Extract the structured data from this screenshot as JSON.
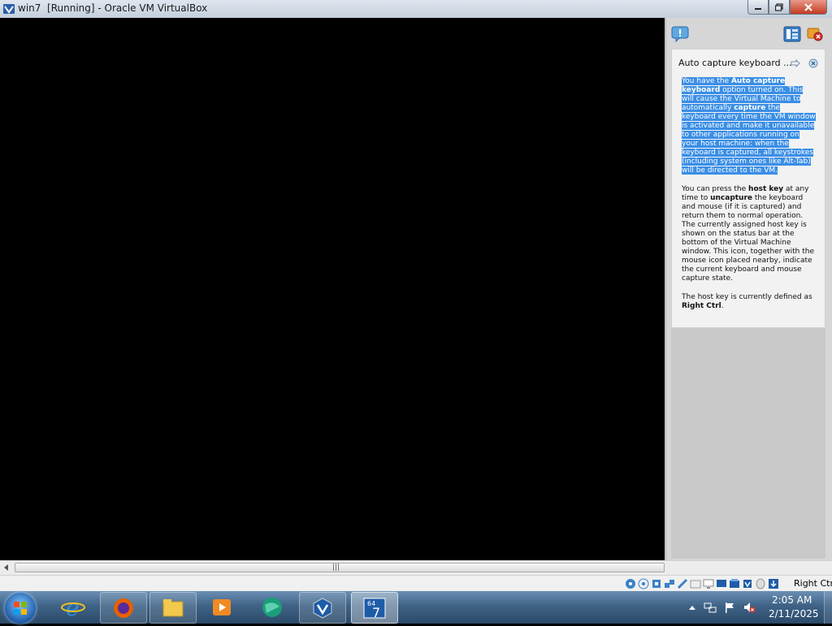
{
  "window": {
    "title": "win7  [Running] - Oracle VM VirtualBox"
  },
  "balloon": {
    "title": "Auto capture keyboard ...",
    "para1": {
      "t1": "You have the ",
      "b1": "Auto capture keyboard",
      "t2": " option turned on. This will cause the Virtual Machine to automatically ",
      "b2": "capture",
      "t3": " the keyboard every time the VM window is activated and make it unavailable to other applications running on your host machine: when the keyboard is captured, all keystrokes (including system ones like Alt-Tab) will be directed to the VM."
    },
    "para2": {
      "t1": "You can press the ",
      "b1": "host key",
      "t2": " at any time to ",
      "b2": "uncapture",
      "t3": " the keyboard and mouse (if it is captured) and return them to normal operation. The currently assigned host key is shown on the status bar at the bottom of the Virtual Machine window. This icon, together with the mouse icon placed nearby, indicate the current keyboard and mouse capture state."
    },
    "para3": {
      "t1": "The host key is currently defined as ",
      "b1": "Right Ctrl",
      "t2": "."
    }
  },
  "statusbar": {
    "host_key": "Right Ctrl",
    "icons": [
      "hard-disk-icon",
      "optical-drive-icon",
      "audio-icon",
      "network-icon",
      "usb-icon",
      "shared-folders-icon",
      "display-icon",
      "recording-icon",
      "vt-x-icon",
      "cpu-icon",
      "mouse-integration-icon",
      "keyboard-capture-icon"
    ]
  },
  "taskbar": {
    "items": [
      "start-button",
      "internet-explorer",
      "firefox",
      "windows-explorer",
      "media-player",
      "browser-app",
      "virtualbox-manager",
      "virtualbox-vm-win7"
    ],
    "clock": {
      "time": "2:05 AM",
      "date": "2/11/2025"
    }
  },
  "colors": {
    "selection": "#3a8ee6",
    "taskbar": "#3f6386",
    "panel": "#d6d6d6"
  }
}
